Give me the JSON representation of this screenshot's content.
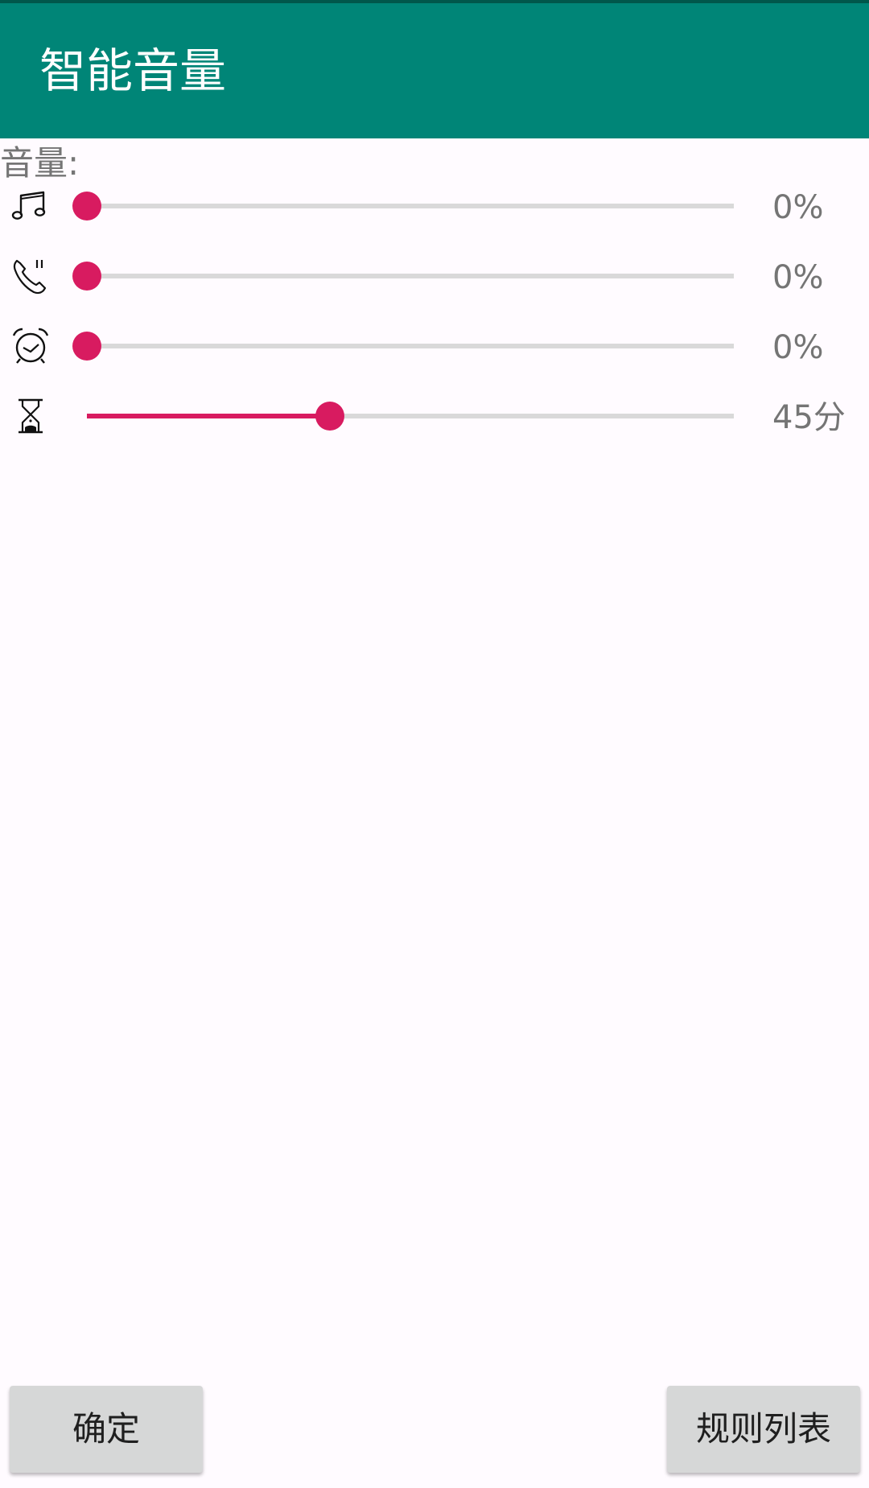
{
  "app_bar": {
    "title": "智能音量"
  },
  "volume_section": {
    "label": "音量:"
  },
  "sliders": [
    {
      "icon": "music-note-icon",
      "level_percent": 0,
      "value_text": "0%"
    },
    {
      "icon": "phone-ring-icon",
      "level_percent": 0,
      "value_text": "0%"
    },
    {
      "icon": "alarm-clock-icon",
      "level_percent": 0,
      "value_text": "0%"
    },
    {
      "icon": "hourglass-icon",
      "level_percent": 37.5,
      "value_text": "45分"
    }
  ],
  "buttons": {
    "confirm_label": "确定",
    "rules_label": "规则列表"
  },
  "colors": {
    "app_bar": "#008577",
    "status_bar": "#00574b",
    "accent": "#d81b60",
    "track": "#d9d9d9",
    "background": "#fffbff",
    "button": "#d6d7d7"
  }
}
